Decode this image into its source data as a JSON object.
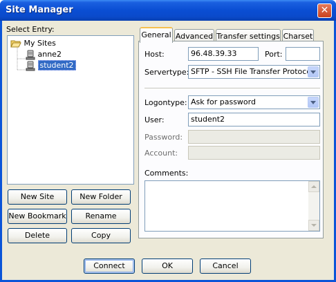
{
  "window": {
    "title": "Site Manager",
    "close_glyph": "✕"
  },
  "left": {
    "select_entry_label": "Select Entry:",
    "tree": {
      "root": "My Sites",
      "children": [
        "anne2",
        "student2"
      ],
      "selected": "student2"
    },
    "buttons": {
      "new_site": "New Site",
      "new_folder": "New Folder",
      "new_bookmark": "New Bookmark",
      "rename": "Rename",
      "delete": "Delete",
      "copy": "Copy"
    }
  },
  "tabs": [
    "General",
    "Advanced",
    "Transfer settings",
    "Charset"
  ],
  "general": {
    "host_label": "Host:",
    "host_value": "96.48.39.33",
    "port_label": "Port:",
    "port_value": "",
    "servertype_label": "Servertype:",
    "servertype_value": "SFTP - SSH File Transfer Protocol",
    "logontype_label": "Logontype:",
    "logontype_value": "Ask for password",
    "user_label": "User:",
    "user_value": "student2",
    "password_label": "Password:",
    "account_label": "Account:",
    "comments_label": "Comments:"
  },
  "footer": {
    "connect": "Connect",
    "ok": "OK",
    "cancel": "Cancel"
  },
  "colors": {
    "title_bar": "#0a4ed3",
    "dialog_bg": "#ece9d8",
    "selection": "#316ac5",
    "active_tab_accent": "#f5c04f"
  }
}
